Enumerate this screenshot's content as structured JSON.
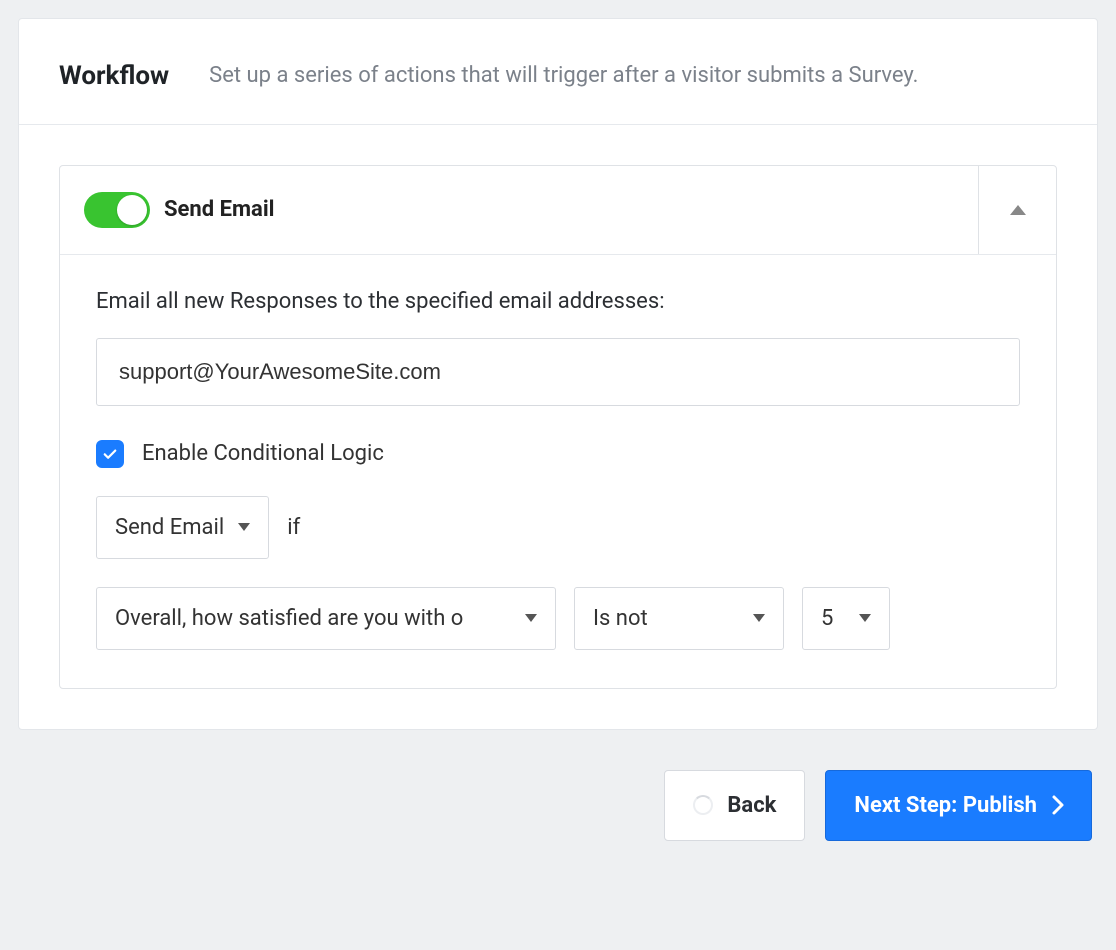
{
  "header": {
    "title": "Workflow",
    "description": "Set up a series of actions that will trigger after a visitor submits a Survey."
  },
  "action": {
    "enabled": true,
    "name": "Send Email",
    "email_field_label": "Email all new Responses to the specified email addresses:",
    "email_value": "support@YourAwesomeSite.com",
    "conditional": {
      "enabled": true,
      "checkbox_label": "Enable Conditional Logic",
      "action_select": "Send Email",
      "connector": "if",
      "question_select": "Overall, how satisfied are you with o",
      "operator_select": "Is not",
      "value_select": "5"
    }
  },
  "footer": {
    "back_label": "Back",
    "next_label": "Next Step: Publish"
  }
}
